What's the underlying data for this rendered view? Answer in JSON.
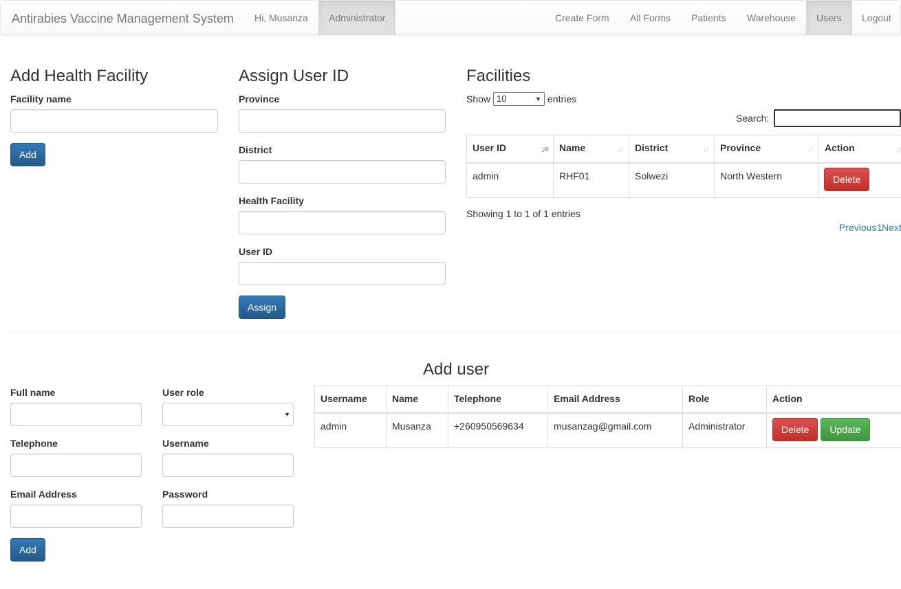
{
  "navbar": {
    "brand": "Antirabies Vaccine Management System",
    "greeting": "Hi, Musanza",
    "role": "Administrator",
    "links": [
      "Create Form",
      "All Forms",
      "Patients",
      "Warehouse",
      "Users",
      "Logout"
    ],
    "active_link": "Users"
  },
  "add_facility": {
    "title": "Add Health Facility",
    "facility_label": "Facility name",
    "facility_value": "",
    "add_label": "Add"
  },
  "assign": {
    "title": "Assign User ID",
    "province_label": "Province",
    "district_label": "District",
    "facility_label": "Health Facility",
    "userid_label": "User ID",
    "assign_label": "Assign"
  },
  "facilities": {
    "title": "Facilities",
    "show_label": "Show",
    "page_size": "10",
    "entries_label": "entries",
    "search_label": "Search:",
    "columns": [
      "User ID",
      "Name",
      "District",
      "Province",
      "Action"
    ],
    "rows": [
      {
        "user_id": "admin",
        "name": "RHF01",
        "district": "Solwezi",
        "province": "North Western",
        "action": "Delete"
      }
    ],
    "info": "Showing 1 to 1 of 1 entries",
    "previous": "Previous",
    "page": "1",
    "next": "Next"
  },
  "add_user": {
    "title": "Add user",
    "fullname_label": "Full name",
    "role_label": "User role",
    "telephone_label": "Telephone",
    "username_label": "Username",
    "email_label": "Email Address",
    "password_label": "Password",
    "add_label": "Add"
  },
  "users": {
    "columns": [
      "Username",
      "Name",
      "Telephone",
      "Email Address",
      "Role",
      "Action"
    ],
    "rows": [
      {
        "username": "admin",
        "name": "Musanza",
        "telephone": "+260950569634",
        "email": "musanzag@gmail.com",
        "role": "Administrator",
        "delete": "Delete",
        "update": "Update"
      }
    ]
  }
}
